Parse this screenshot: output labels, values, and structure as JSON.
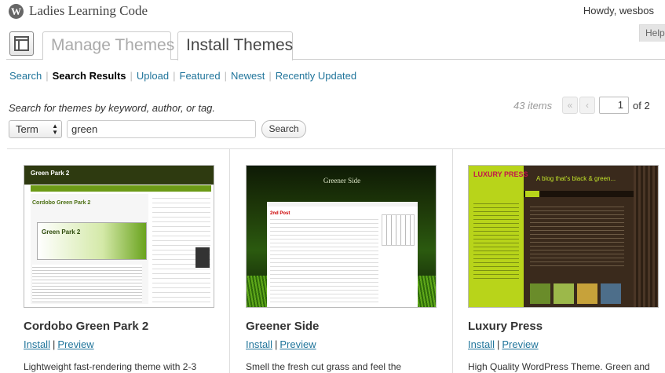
{
  "site": {
    "title": "Ladies Learning Code",
    "howdy": "Howdy, wesbos",
    "help": "Help"
  },
  "tabs": {
    "manage": "Manage Themes",
    "install": "Install Themes"
  },
  "subnav": [
    "Search",
    "Search Results",
    "Upload",
    "Featured",
    "Newest",
    "Recently Updated"
  ],
  "subnav_current": "Search Results",
  "search": {
    "hint": "Search for themes by keyword, author, or tag.",
    "type_label": "Term",
    "value": "green",
    "button": "Search"
  },
  "pagination": {
    "items": "43 items",
    "first": "«",
    "prev": "‹",
    "current_page": "1",
    "of": "of 2"
  },
  "themes": [
    {
      "name": "Cordobo Green Park 2",
      "install": "Install",
      "preview": "Preview",
      "description": "Lightweight fast-rendering theme with 2-3",
      "shot": {
        "header": "Green Park 2",
        "heading": "Cordobo Green Park 2",
        "banner": "Green Park 2"
      }
    },
    {
      "name": "Greener Side",
      "install": "Install",
      "preview": "Preview",
      "description": "Smell the fresh cut grass and feel the",
      "shot": {
        "logo": "Greener Side",
        "post": "2nd Post"
      }
    },
    {
      "name": "Luxury Press",
      "install": "Install",
      "preview": "Preview",
      "description": "High Quality WordPress Theme. Green and",
      "shot": {
        "logo": "LUXURY PRESS",
        "tagline": "A blog that's black & green..."
      }
    }
  ],
  "icons": {
    "wp_logo": "wordpress-logo-icon",
    "themes": "appearance-icon",
    "select": "updown-arrows-icon"
  },
  "colors": {
    "link": "#21759b",
    "text": "#333333",
    "muted": "#999999"
  }
}
